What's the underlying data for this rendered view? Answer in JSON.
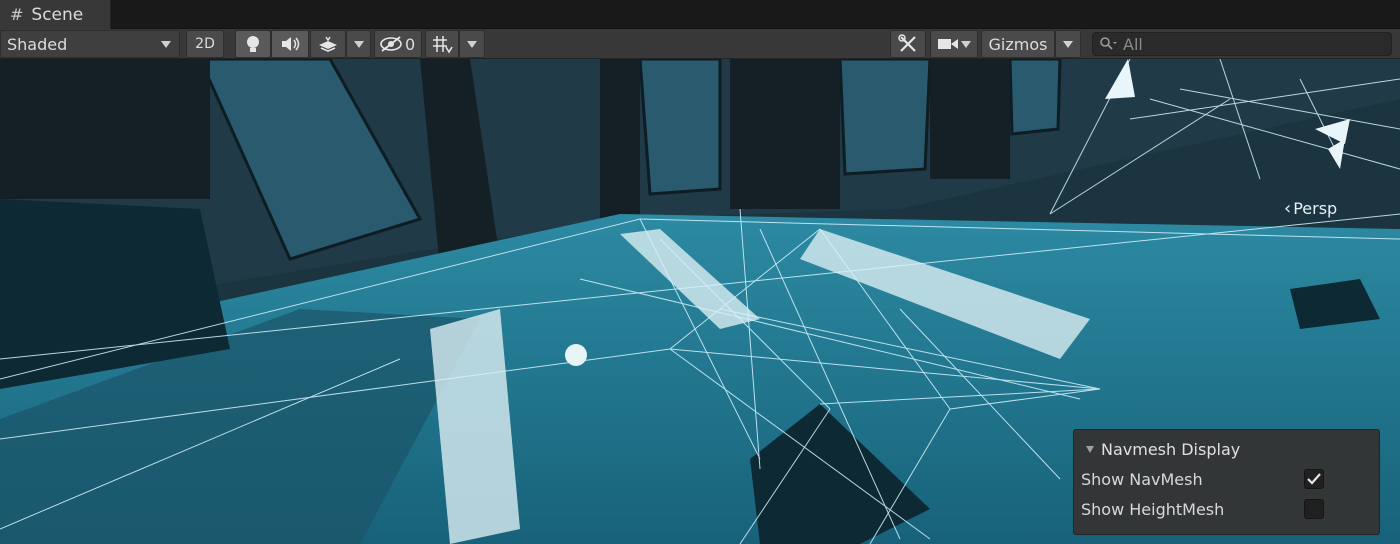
{
  "tab": {
    "label": "Scene",
    "icon": "hash-icon"
  },
  "toolbar": {
    "draw_mode": "Shaded",
    "mode_2d": "2D",
    "hidden_count": "0",
    "gizmos": "Gizmos",
    "search_placeholder": "All"
  },
  "viewport": {
    "persp_label": "Persp"
  },
  "navmesh_panel": {
    "title": "Navmesh Display",
    "rows": [
      {
        "label": "Show NavMesh",
        "checked": true
      },
      {
        "label": "Show HeightMesh",
        "checked": false
      }
    ]
  },
  "colors": {
    "floor": "#1f6c80",
    "navmesh_line": "#cfefff",
    "panel": "#343434",
    "toolbar": "#383838"
  }
}
